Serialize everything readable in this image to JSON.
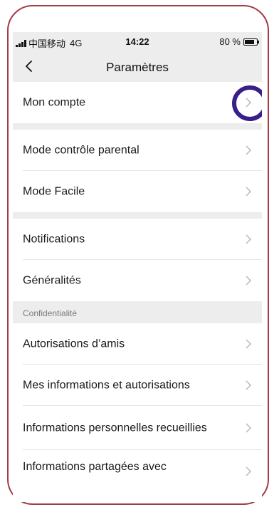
{
  "status_bar": {
    "carrier": "中国移动",
    "network": "4G",
    "time": "14:22",
    "battery": "80 %",
    "battery_level": 0.8
  },
  "nav": {
    "title": "Paramètres",
    "back_icon": "chevron-left-icon"
  },
  "rows": {
    "mon_compte": "Mon compte",
    "controle_parental": "Mode contrôle parental",
    "mode_facile": "Mode Facile",
    "notifications": "Notifications",
    "generalites": "Généralités",
    "autorisations_amis": "Autorisations d’amis",
    "mes_informations": "Mes informations et autorisations",
    "informations_personnelles": "Informations personnelles recueillies",
    "informations_partagees": "Informations partagées avec"
  },
  "sections": {
    "confidentialite": "Confidentialité"
  },
  "colors": {
    "frame_border": "#a33a48",
    "highlight_circle": "#3a1f8a",
    "header_background": "#ededed"
  }
}
